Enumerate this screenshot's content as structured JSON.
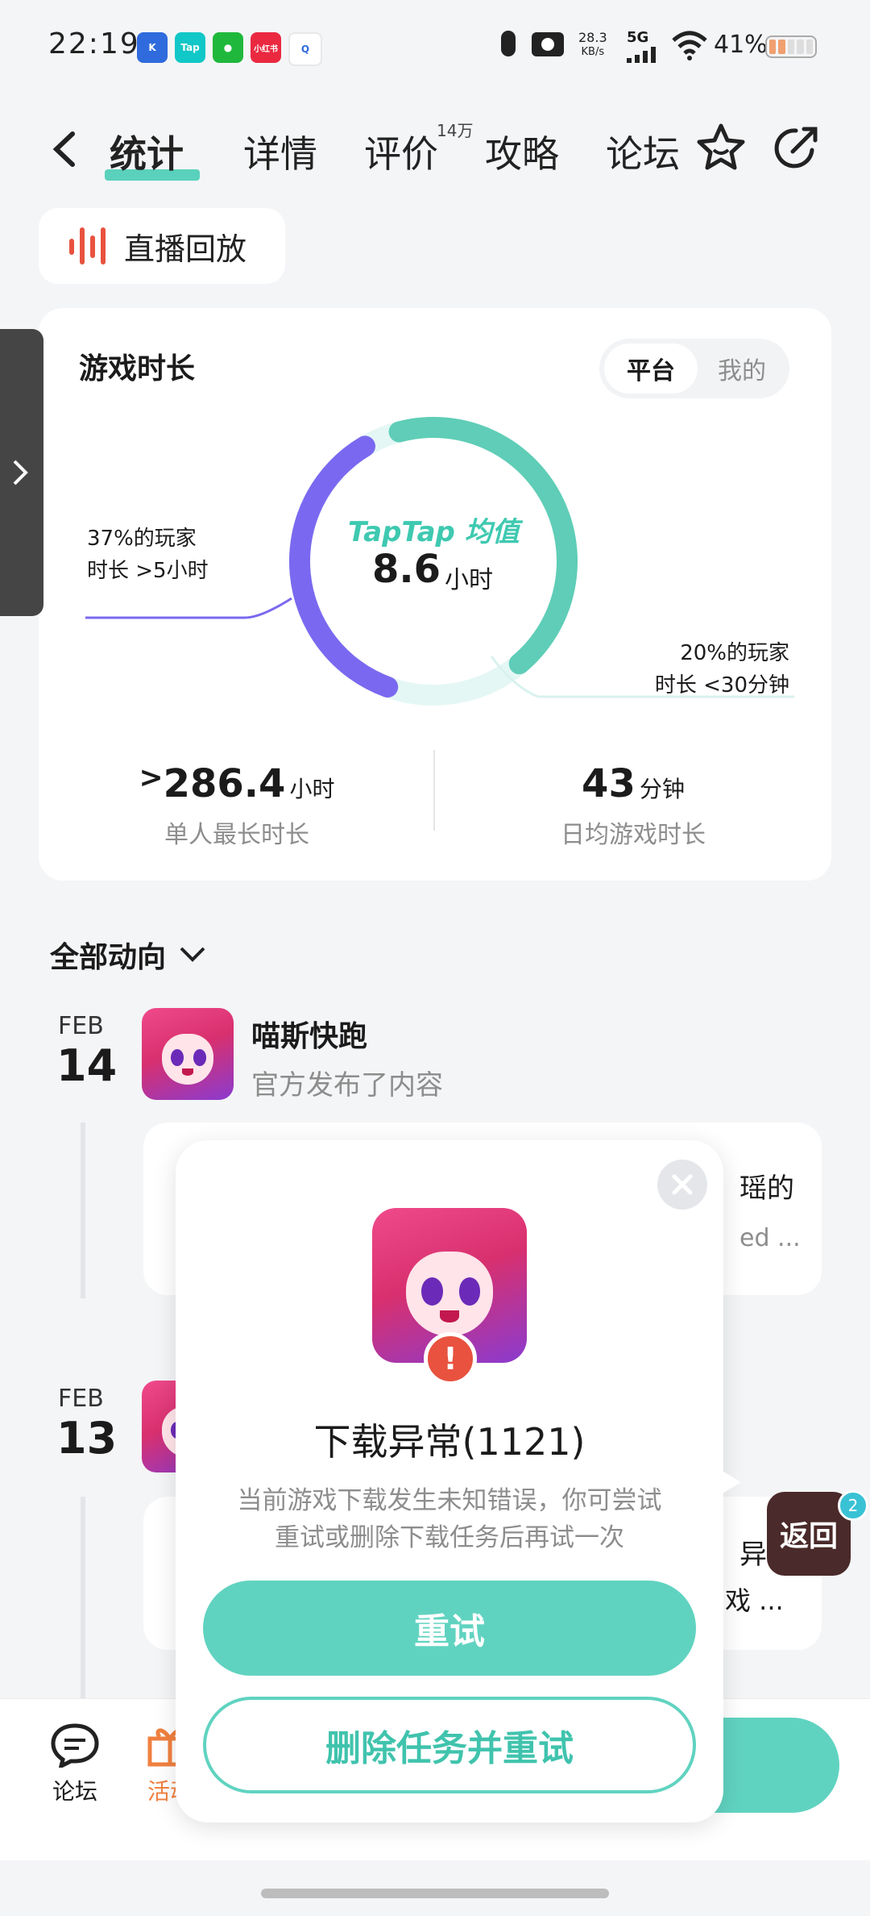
{
  "status_bar": {
    "time": "22:19",
    "net_speed": "28.3",
    "net_unit": "KB/s",
    "network": "5G",
    "battery": "41%",
    "app_icons": [
      {
        "label": "K",
        "color": "#2f6bdc"
      },
      {
        "label": "Tap",
        "color": "#12c7c7"
      },
      {
        "label": "",
        "color": "#1fb83c"
      },
      {
        "label": "小红书",
        "color": "#ea2940"
      },
      {
        "label": "Q",
        "color": "#ffffff"
      }
    ]
  },
  "nav": {
    "back_icon": "chevron-left-icon",
    "tabs": [
      "统计",
      "详情",
      "评价",
      "攻略",
      "论坛"
    ],
    "review_count_badge": "14万",
    "favorite_icon": "star-icon",
    "share_icon": "share-icon"
  },
  "live_replay": {
    "icon": "sound-wave-icon",
    "label": "直播回放"
  },
  "playtime_card": {
    "title": "游戏时长",
    "toggle": [
      "平台",
      "我的"
    ],
    "toggle_selected": "平台",
    "center_brand": "TapTap 均值",
    "center_value": "8.6",
    "center_unit": "小时",
    "left_note_line1": "37%的玩家",
    "left_note_line2": "时长 >5小时",
    "right_note_line1": "20%的玩家",
    "right_note_line2": "时长 <30分钟",
    "ring_segments": [
      {
        "name": ">5h",
        "percent": 37,
        "color": "#7a69f0"
      },
      {
        "name": "middle",
        "percent": 43,
        "color": "#5fcdb7"
      },
      {
        "name": "<30min",
        "percent": 20,
        "color": "#e3f6f3"
      }
    ],
    "stats": [
      {
        "prefix": ">",
        "value": "286.4",
        "unit": "小时",
        "label": "单人最长时长"
      },
      {
        "prefix": "",
        "value": "43",
        "unit": "分钟",
        "label": "日均游戏时长"
      }
    ]
  },
  "feed": {
    "filter_label": "全部动向",
    "entries": [
      {
        "month": "FEB",
        "day": "14",
        "author": "喵斯快跑",
        "action": "官方发布了内容",
        "snippet_right": "瑶的",
        "snippet_right2": "ed ..."
      },
      {
        "month": "FEB",
        "day": "13",
        "author": "",
        "action": "",
        "snippet_right": "异常",
        "snippet_right2": "戏 ..."
      }
    ]
  },
  "bottom_bar": {
    "items": [
      {
        "icon": "chat-bubble-icon",
        "label": "论坛"
      },
      {
        "icon": "gift-icon",
        "label": "活动"
      }
    ]
  },
  "float_return": {
    "label": "返回",
    "badge": "2"
  },
  "dialog": {
    "title": "下载异常(1121)",
    "message_line1": "当前游戏下载发生未知错误，你可尝试",
    "message_line2": "重试或删除下载任务后再试一次",
    "retry_label": "重试",
    "delete_retry_label": "删除任务并重试",
    "close_icon": "close-icon",
    "error_icon": "exclamation-icon"
  },
  "colors": {
    "accent": "#60d3c0",
    "purple": "#7a69f0",
    "error": "#e8523f",
    "orange": "#f08040"
  }
}
